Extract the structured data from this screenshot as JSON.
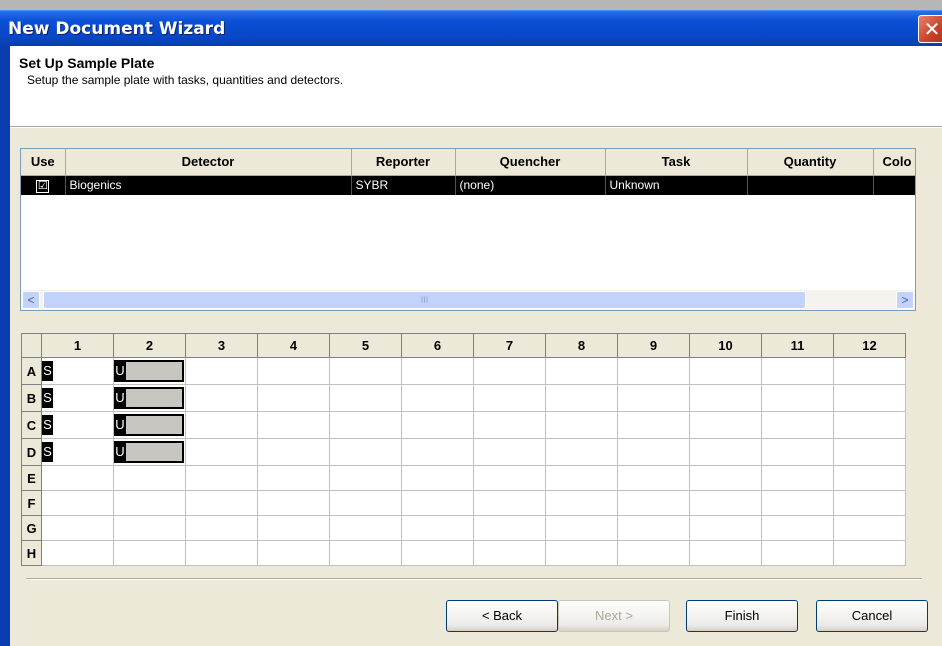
{
  "window": {
    "title": "New Document Wizard",
    "close_glyph": "✕"
  },
  "header": {
    "title": "Set Up Sample Plate",
    "subtitle": "Setup the sample plate with tasks, quantities and detectors."
  },
  "detector_table": {
    "columns": [
      "Use",
      "Detector",
      "Reporter",
      "Quencher",
      "Task",
      "Quantity",
      "Colo"
    ],
    "rows": [
      {
        "use": "☑",
        "detector": "Biogenics",
        "reporter": "SYBR",
        "quencher": "(none)",
        "task": "Unknown",
        "quantity": "",
        "color": ""
      }
    ]
  },
  "scrollbar": {
    "left_arrow": "<",
    "right_arrow": ">",
    "thumb_grip": "III"
  },
  "plate": {
    "columns": [
      "1",
      "2",
      "3",
      "4",
      "5",
      "6",
      "7",
      "8",
      "9",
      "10",
      "11",
      "12"
    ],
    "rows": [
      "A",
      "B",
      "C",
      "D",
      "E",
      "F",
      "G",
      "H"
    ],
    "wells": {
      "A": [
        "S",
        "U"
      ],
      "B": [
        "S",
        "U"
      ],
      "C": [
        "S",
        "U"
      ],
      "D": [
        "S",
        "U"
      ]
    }
  },
  "buttons": {
    "back": "< Back",
    "next": "Next >",
    "finish": "Finish",
    "cancel": "Cancel"
  }
}
